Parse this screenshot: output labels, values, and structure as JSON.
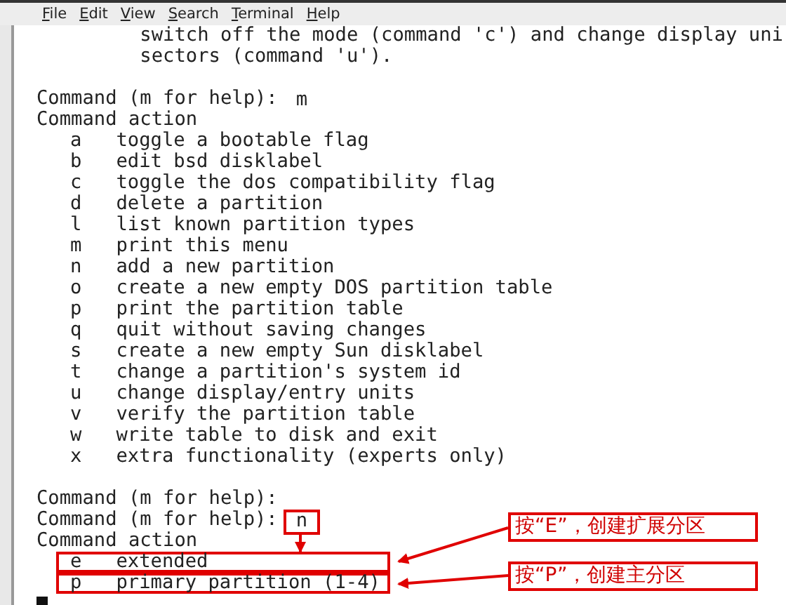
{
  "menu": [
    {
      "label": "File"
    },
    {
      "label": "Edit"
    },
    {
      "label": "View"
    },
    {
      "label": "Search"
    },
    {
      "label": "Terminal"
    },
    {
      "label": "Help"
    }
  ],
  "lines": [
    {
      "kind": "text",
      "text": "         switch off the mode (command 'c') and change display uni"
    },
    {
      "kind": "text",
      "text": "         sectors (command 'u')."
    },
    {
      "kind": "blank"
    },
    {
      "kind": "prompt",
      "prompt": "Command (m for help):",
      "input": "m"
    },
    {
      "kind": "text",
      "text": "Command action"
    },
    {
      "kind": "option",
      "key": "a",
      "desc": "toggle a bootable flag"
    },
    {
      "kind": "option",
      "key": "b",
      "desc": "edit bsd disklabel"
    },
    {
      "kind": "option",
      "key": "c",
      "desc": "toggle the dos compatibility flag"
    },
    {
      "kind": "option",
      "key": "d",
      "desc": "delete a partition"
    },
    {
      "kind": "option",
      "key": "l",
      "desc": "list known partition types"
    },
    {
      "kind": "option",
      "key": "m",
      "desc": "print this menu"
    },
    {
      "kind": "option",
      "key": "n",
      "desc": "add a new partition"
    },
    {
      "kind": "option",
      "key": "o",
      "desc": "create a new empty DOS partition table"
    },
    {
      "kind": "option",
      "key": "p",
      "desc": "print the partition table"
    },
    {
      "kind": "option",
      "key": "q",
      "desc": "quit without saving changes"
    },
    {
      "kind": "option",
      "key": "s",
      "desc": "create a new empty Sun disklabel"
    },
    {
      "kind": "option",
      "key": "t",
      "desc": "change a partition's system id"
    },
    {
      "kind": "option",
      "key": "u",
      "desc": "change display/entry units"
    },
    {
      "kind": "option",
      "key": "v",
      "desc": "verify the partition table"
    },
    {
      "kind": "option",
      "key": "w",
      "desc": "write table to disk and exit"
    },
    {
      "kind": "option",
      "key": "x",
      "desc": "extra functionality (experts only)"
    },
    {
      "kind": "blank"
    },
    {
      "kind": "prompt",
      "prompt": "Command (m for help):"
    },
    {
      "kind": "prompt",
      "prompt": "Command (m for help):",
      "input": "n",
      "boxed": true
    },
    {
      "kind": "text",
      "text": "Command action"
    },
    {
      "kind": "option",
      "key": "e",
      "desc": "extended",
      "boxed": true
    },
    {
      "kind": "option",
      "key": "p",
      "desc": "primary partition (1-4)",
      "boxed": true
    },
    {
      "kind": "cursor"
    }
  ],
  "callouts": [
    {
      "text": "按“E”，创建扩展分区"
    },
    {
      "text": "按“P”，创建主分区"
    }
  ]
}
